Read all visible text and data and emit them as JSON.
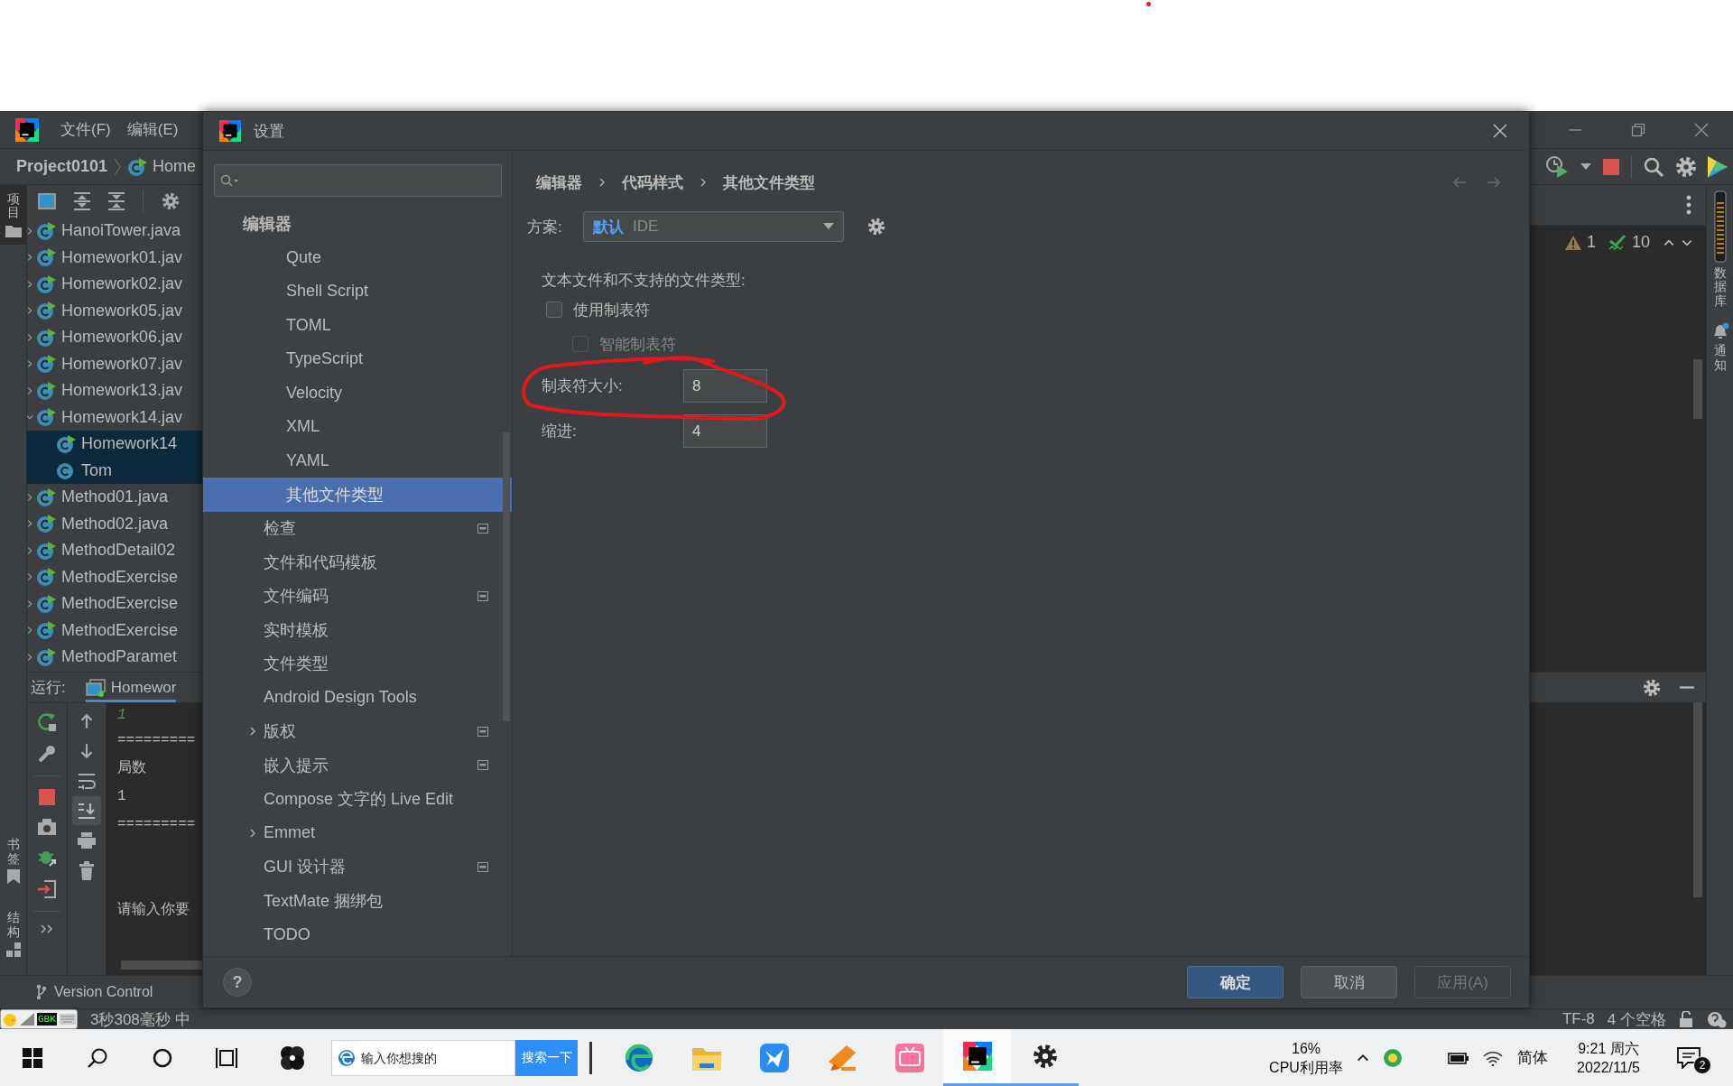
{
  "ide": {
    "menu": [
      {
        "label": "文件(F)"
      },
      {
        "label": "编辑(E)"
      }
    ],
    "breadcrumb": {
      "project": "Project0101",
      "file": "Home"
    },
    "left_stripe": [
      {
        "label": "项目",
        "kind": "project",
        "selected": true
      },
      {
        "label": "书签",
        "kind": "bookmarks",
        "selected": false
      },
      {
        "label": "结构",
        "kind": "structure",
        "selected": false
      }
    ],
    "project_tree": [
      {
        "name": "HanoiTower.java",
        "runnable": true,
        "expanded": false,
        "selected": false
      },
      {
        "name": "Homework01.jav",
        "runnable": true,
        "expanded": false,
        "selected": false
      },
      {
        "name": "Homework02.jav",
        "runnable": true,
        "expanded": false,
        "selected": false
      },
      {
        "name": "Homework05.jav",
        "runnable": true,
        "expanded": false,
        "selected": false
      },
      {
        "name": "Homework06.jav",
        "runnable": true,
        "expanded": false,
        "selected": false
      },
      {
        "name": "Homework07.jav",
        "runnable": true,
        "expanded": false,
        "selected": false
      },
      {
        "name": "Homework13.jav",
        "runnable": true,
        "expanded": false,
        "selected": false
      },
      {
        "name": "Homework14.jav",
        "runnable": true,
        "expanded": true,
        "selected": false,
        "children": [
          {
            "name": "Homework14",
            "runnable": true,
            "selected": true
          },
          {
            "name": "Tom",
            "runnable": false,
            "selected": true
          }
        ]
      },
      {
        "name": "Method01.java",
        "runnable": true,
        "expanded": false,
        "selected": false
      },
      {
        "name": "Method02.java",
        "runnable": true,
        "expanded": false,
        "selected": false
      },
      {
        "name": "MethodDetail02",
        "runnable": true,
        "expanded": false,
        "selected": false
      },
      {
        "name": "MethodExercise",
        "runnable": true,
        "expanded": false,
        "selected": false
      },
      {
        "name": "MethodExercise",
        "runnable": true,
        "expanded": false,
        "selected": false
      },
      {
        "name": "MethodExercise",
        "runnable": true,
        "expanded": false,
        "selected": false
      },
      {
        "name": "MethodParamet",
        "runnable": true,
        "expanded": false,
        "selected": false
      }
    ],
    "run_panel": {
      "label": "运行:",
      "tab": "Homewor",
      "console": [
        {
          "text": "1",
          "kind": "input"
        },
        {
          "text": "=========",
          "kind": "output"
        },
        {
          "text": "局数",
          "kind": "output"
        },
        {
          "text": "1",
          "kind": "output"
        },
        {
          "text": "=========",
          "kind": "output"
        },
        {
          "text": "请输入你要",
          "kind": "prompt"
        }
      ]
    },
    "inspections": {
      "warnings": "1",
      "passed": "10"
    },
    "right_stripe": [
      {
        "label": "数据库",
        "kind": "database"
      },
      {
        "label": "通知",
        "kind": "notifications"
      }
    ],
    "tool_window_bar": {
      "label": "Version Control"
    },
    "status_bar": {
      "message": "3秒308毫秒 中",
      "encoding": "TF-8",
      "indent": "4 个空格"
    },
    "ime_widget": {
      "label": "GBK"
    }
  },
  "dialog": {
    "title": "设置",
    "tree": [
      {
        "label": "编辑器",
        "selected": false,
        "children": [
          {
            "kind": "group",
            "children": [
              {
                "label": "Qute",
                "selected": false
              },
              {
                "label": "Shell Script",
                "selected": false
              },
              {
                "label": "TOML",
                "selected": false
              },
              {
                "label": "TypeScript",
                "selected": false
              },
              {
                "label": "Velocity",
                "selected": false
              },
              {
                "label": "XML",
                "selected": false
              },
              {
                "label": "YAML",
                "selected": false
              },
              {
                "label": "其他文件类型",
                "selected": true
              }
            ]
          },
          {
            "label": "检查",
            "selected": false,
            "project_scope": true
          },
          {
            "label": "文件和代码模板",
            "selected": false,
            "project_scope": false
          },
          {
            "label": "文件编码",
            "selected": false,
            "project_scope": true
          },
          {
            "label": "实时模板",
            "selected": false,
            "project_scope": false
          },
          {
            "label": "文件类型",
            "selected": false,
            "project_scope": false
          },
          {
            "label": "Android Design Tools",
            "selected": false,
            "project_scope": false
          },
          {
            "label": "版权",
            "selected": false,
            "project_scope": true,
            "expanded": false
          },
          {
            "label": "嵌入提示",
            "selected": false,
            "project_scope": true
          },
          {
            "label": "Compose 文字的 Live Edit",
            "selected": false,
            "project_scope": false
          },
          {
            "label": "Emmet",
            "selected": false,
            "project_scope": false,
            "expanded": false
          },
          {
            "label": "GUI 设计器",
            "selected": false,
            "project_scope": true
          },
          {
            "label": "TextMate 捆绑包",
            "selected": false,
            "project_scope": false
          },
          {
            "label": "TODO",
            "selected": false,
            "project_scope": false
          }
        ]
      }
    ],
    "breadcrumb": [
      "编辑器",
      "代码样式",
      "其他文件类型"
    ],
    "scheme": {
      "label": "方案:",
      "value": "默认",
      "detail": "IDE"
    },
    "section_title": "文本文件和不支持的文件类型:",
    "options": [
      {
        "kind": "checkbox",
        "label": "使用制表符",
        "checked": false,
        "disabled": false,
        "children": [
          {
            "kind": "checkbox",
            "label": "智能制表符",
            "checked": false,
            "disabled": true
          }
        ]
      }
    ],
    "fields": [
      {
        "label": "制表符大小:",
        "value": "8"
      },
      {
        "label": "缩进:",
        "value": "4"
      }
    ],
    "help": "?",
    "buttons": [
      {
        "label": "确定",
        "kind": "primary",
        "disabled": false
      },
      {
        "label": "取消",
        "kind": "normal",
        "disabled": false
      },
      {
        "label": "应用(A)",
        "kind": "normal",
        "disabled": true
      }
    ]
  },
  "taskbar": {
    "search": {
      "placeholder": "输入你想搜的",
      "button": "搜索一下"
    },
    "apps": [
      {
        "kind": "edge",
        "running": false,
        "active": false
      },
      {
        "kind": "folder",
        "running": false,
        "active": false
      },
      {
        "kind": "bird",
        "running": false,
        "active": false
      },
      {
        "kind": "orange",
        "running": false,
        "active": false
      },
      {
        "kind": "tv",
        "running": false,
        "active": false
      },
      {
        "kind": "ide",
        "running": true,
        "active": true
      },
      {
        "kind": "settings",
        "running": true,
        "active": false
      }
    ],
    "cpu": {
      "value": "16%",
      "label": "CPU利用率"
    },
    "ime": "简体",
    "clock": {
      "time": "9:21 周六",
      "date": "2022/11/5"
    },
    "notifications": "2"
  }
}
